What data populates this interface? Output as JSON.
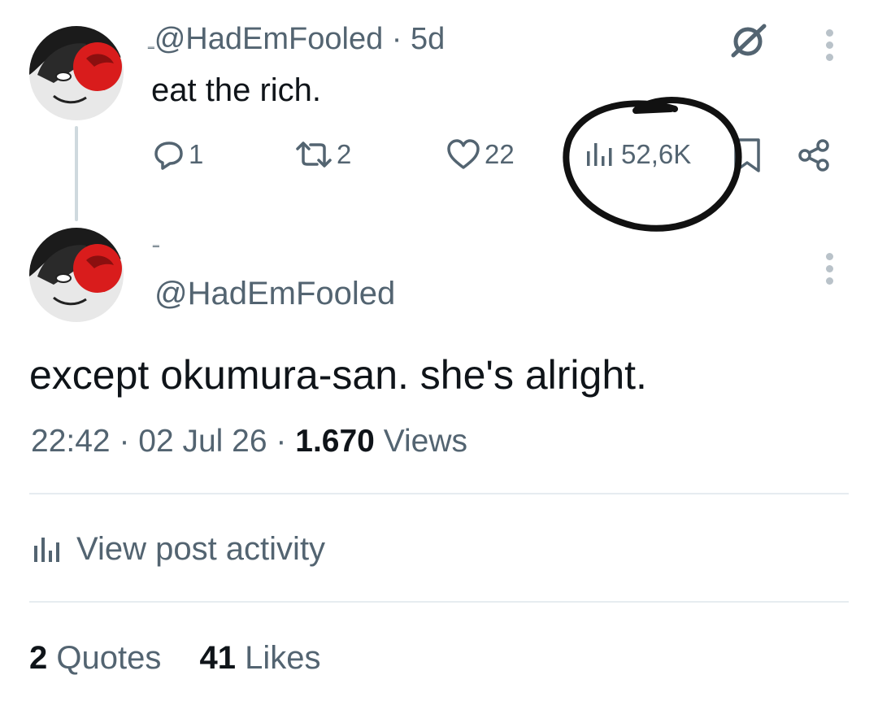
{
  "first_post": {
    "handle": "@HadEmFooled",
    "time": "5d",
    "text": "eat the rich.",
    "replies": "1",
    "reposts": "2",
    "likes": "22",
    "views": "52,6K"
  },
  "second_post": {
    "handle": "@HadEmFooled",
    "text": "except okumura-san. she's alright.",
    "time": "22:42",
    "date": "02 Jul 26",
    "views_count": "1.670",
    "views_label": "Views"
  },
  "activity": {
    "label": "View post activity"
  },
  "stats": {
    "quotes_count": "2",
    "quotes_label": "Quotes",
    "likes_count": "41",
    "likes_label": "Likes"
  },
  "colors": {
    "text": "#0f1419",
    "secondary": "#536471",
    "avatar_red": "#d91c1c"
  }
}
